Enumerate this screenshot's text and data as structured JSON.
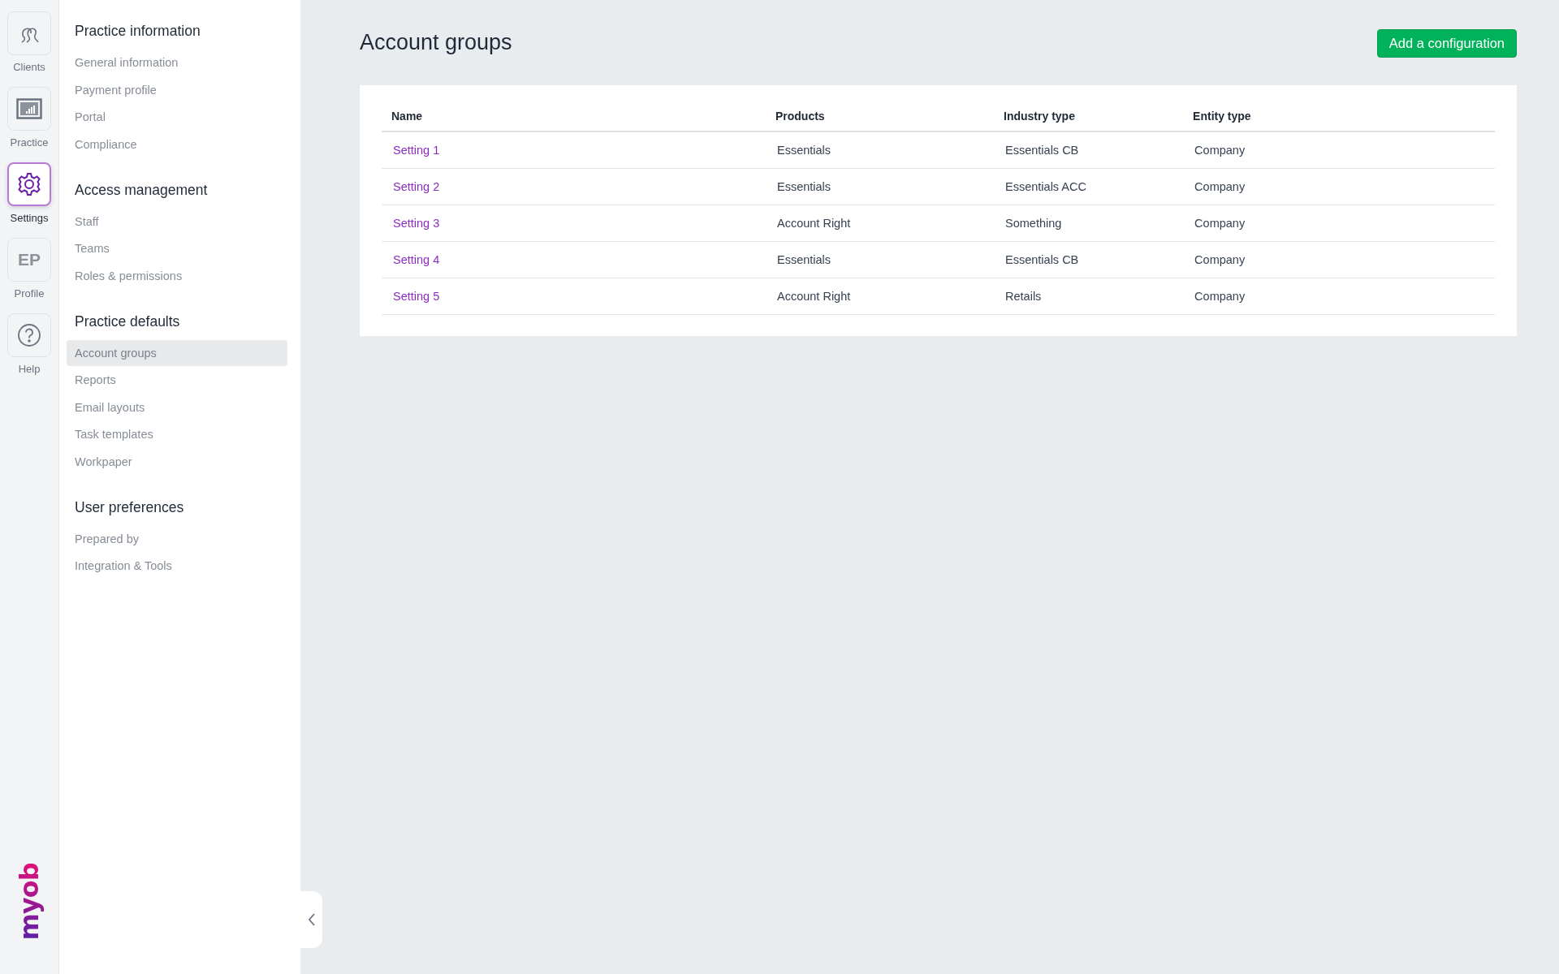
{
  "rail": {
    "items": [
      {
        "kind": "clients",
        "label": "Clients",
        "selected": false
      },
      {
        "kind": "practice",
        "label": "Practice",
        "selected": false
      },
      {
        "kind": "settings",
        "label": "Settings",
        "selected": true
      },
      {
        "kind": "initials",
        "initials": "EP",
        "label": "Profile",
        "selected": false
      },
      {
        "kind": "help",
        "label": "Help",
        "selected": false
      }
    ],
    "logo": "myob"
  },
  "sidebar": {
    "sections": [
      {
        "heading": "Practice information",
        "items": [
          {
            "label": "General information",
            "selected": false
          },
          {
            "label": "Payment profile",
            "selected": false
          },
          {
            "label": "Portal",
            "selected": false
          },
          {
            "label": "Compliance",
            "selected": false
          }
        ]
      },
      {
        "heading": "Access management",
        "items": [
          {
            "label": "Staff",
            "selected": false
          },
          {
            "label": "Teams",
            "selected": false
          },
          {
            "label": "Roles & permissions",
            "selected": false
          }
        ]
      },
      {
        "heading": "Practice defaults",
        "items": [
          {
            "label": "Account groups",
            "selected": true
          },
          {
            "label": "Reports",
            "selected": false
          },
          {
            "label": "Email layouts",
            "selected": false
          },
          {
            "label": "Task templates",
            "selected": false
          },
          {
            "label": "Workpaper",
            "selected": false
          }
        ]
      },
      {
        "heading": "User preferences",
        "items": [
          {
            "label": "Prepared by",
            "selected": false
          },
          {
            "label": "Integration & Tools",
            "selected": false
          }
        ]
      }
    ]
  },
  "page": {
    "title": "Account groups",
    "action_button": "Add a configuration"
  },
  "table": {
    "columns": [
      "Name",
      "Products",
      "Industry type",
      "Entity type"
    ],
    "rows": [
      [
        "Setting 1",
        "Essentials",
        "Essentials CB",
        "Company"
      ],
      [
        "Setting 2",
        "Essentials",
        "Essentials ACC",
        "Company"
      ],
      [
        "Setting 3",
        "Account Right",
        "Something",
        "Company"
      ],
      [
        "Setting 4",
        "Essentials",
        "Essentials CB",
        "Company"
      ],
      [
        "Setting 5",
        "Account Right",
        "Retails",
        "Company"
      ]
    ]
  }
}
